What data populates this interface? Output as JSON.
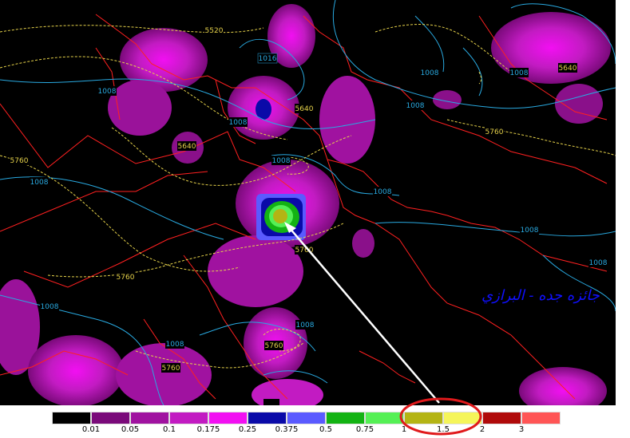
{
  "map": {
    "signature_text": "جائزه جده - البرازي",
    "contour_labels_pressure": [
      {
        "text": "1016"
      },
      {
        "text": "1008"
      },
      {
        "text": "1008"
      },
      {
        "text": "1008"
      },
      {
        "text": "1008"
      },
      {
        "text": "1008"
      },
      {
        "text": "1008"
      },
      {
        "text": "1008"
      },
      {
        "text": "1008"
      },
      {
        "text": "1008"
      },
      {
        "text": "1008"
      },
      {
        "text": "1008"
      },
      {
        "text": "1008"
      },
      {
        "text": "1008"
      }
    ],
    "contour_labels_height": [
      {
        "text": "5520"
      },
      {
        "text": "5640"
      },
      {
        "text": "5640"
      },
      {
        "text": "5640"
      },
      {
        "text": "5760"
      },
      {
        "text": "5760"
      },
      {
        "text": "5760"
      },
      {
        "text": "5760"
      },
      {
        "text": "5760"
      },
      {
        "text": "5760"
      }
    ],
    "colors": {
      "background": "#000000",
      "borders": "#ff2020",
      "pressure_contours": "#29a9e0",
      "height_contours": "#e6d24a",
      "arrow": "#ffffff",
      "highlight_circle": "#e0191b"
    }
  },
  "legend": {
    "colors": [
      "#000000",
      "#7a0a7a",
      "#a012a0",
      "#c21bc2",
      "#f20ff2",
      "#0a0aa8",
      "#5a5aff",
      "#13b313",
      "#55f055",
      "#b4b414",
      "#f5f55a",
      "#b00a0a",
      "#ff5555"
    ],
    "tick_labels": [
      "0.01",
      "0.05",
      "0.1",
      "0.175",
      "0.25",
      "0.375",
      "0.5",
      "0.75",
      "1",
      "1.5",
      "2",
      "3"
    ]
  }
}
